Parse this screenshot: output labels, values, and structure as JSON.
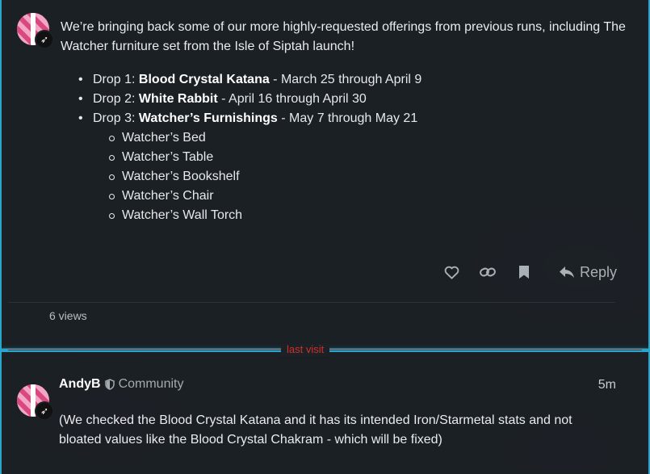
{
  "post1": {
    "intro": "We’re bringing back some of our more highly-requested offerings from previous runs, including The Watcher furniture set from the Isle of Siptah launch!",
    "drops": [
      {
        "prefix": "Drop 1: ",
        "name": "Blood Crystal Katana",
        "dates": " - March 25 through April 9"
      },
      {
        "prefix": "Drop 2: ",
        "name": "White Rabbit",
        "dates": " - April 16 through April 30"
      },
      {
        "prefix": "Drop 3: ",
        "name": "Watcher’s Furnishings",
        "dates": " - May 7 through May 21"
      }
    ],
    "furnishings": [
      "Watcher’s Bed",
      "Watcher’s Table",
      "Watcher’s Bookshelf",
      "Watcher’s Chair",
      "Watcher’s Wall Torch"
    ],
    "actions": {
      "like_icon": "heart-icon",
      "link_icon": "link-icon",
      "bookmark_icon": "bookmark-icon",
      "reply_icon": "reply-icon",
      "reply_label": "Reply"
    },
    "views": "6 views"
  },
  "last_visit": "last visit",
  "post2": {
    "author": "AndyB",
    "group": "Community",
    "time": "5m",
    "body": "(We checked the Blood Crystal Katana and it has its intended Iron/Starmetal stats and not bloated values like the Blood Crystal Chakram - which will be fixed)"
  },
  "colors": {
    "accent": "#2aa6cc",
    "last_visit": "#d0302a",
    "avatar": "#e8629a"
  }
}
